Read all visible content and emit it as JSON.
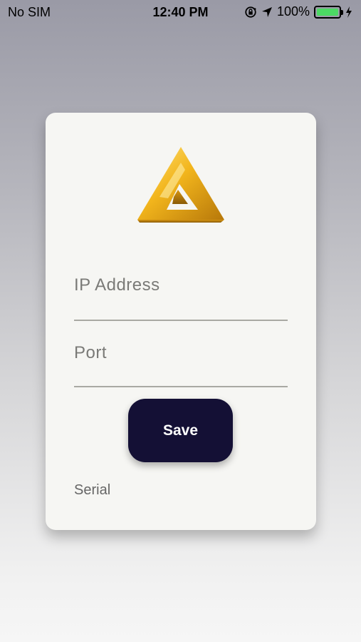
{
  "status_bar": {
    "carrier": "No SIM",
    "time": "12:40 PM",
    "battery_percent": "100%",
    "battery_level": 1.0,
    "icons": [
      "orientation-lock-icon",
      "location-arrow-icon",
      "battery-icon",
      "charging-bolt-icon"
    ],
    "battery_color": "#4cd964"
  },
  "card": {
    "logo_icon": "triangle-logo-icon",
    "ip_field": {
      "placeholder": "IP Address",
      "value": ""
    },
    "port_field": {
      "placeholder": "Port",
      "value": ""
    },
    "save_label": "Save",
    "serial_label": "Serial"
  },
  "colors": {
    "button_bg": "#141035",
    "card_bg": "#f6f6f3",
    "logo_gold": "#e8a819"
  }
}
